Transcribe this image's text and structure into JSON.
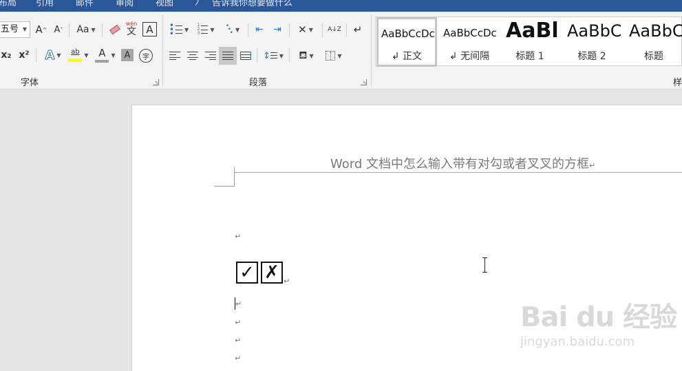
{
  "tabs": [
    {
      "label": "布局"
    },
    {
      "label": "引用"
    },
    {
      "label": "邮件"
    },
    {
      "label": "审阅"
    },
    {
      "label": "视图"
    }
  ],
  "tell_me": "告诉我你想要做什么",
  "font_group": {
    "label": "字体",
    "font_size": "五号",
    "change_case": "Aa",
    "phonetic_top": "wén",
    "phonetic_bottom": "文",
    "border_char": "A",
    "subscript": "x₂",
    "superscript": "x²",
    "text_effects": "A",
    "highlight": "ab",
    "font_color": "A",
    "char_shading": "A",
    "enclose_char": "字",
    "grow_font": "A",
    "shrink_font": "A"
  },
  "paragraph_group": {
    "label": "段落",
    "sort_label": "A↓Z"
  },
  "styles_group": {
    "label": "样式",
    "items": [
      {
        "sample": "AaBbCcDc",
        "name": "↲ 正文"
      },
      {
        "sample": "AaBbCcDc",
        "name": "↲ 无间隔"
      },
      {
        "sample": "AaBl",
        "name": "标题 1"
      },
      {
        "sample": "AaBbC",
        "name": "标题 2"
      },
      {
        "sample": "AaBbC",
        "name": "标题"
      }
    ]
  },
  "document": {
    "header_text": "Word 文档中怎么输入带有对勾或者叉叉的方框",
    "paragraph_mark": "↵",
    "check_box": "✓",
    "cross_box": "✗"
  },
  "watermark": {
    "brand": "Bai du 经验",
    "url": "jingyan.baidu.com"
  },
  "colors": {
    "title_bar": "#2b579a",
    "highlight_yellow": "#ffff00",
    "font_color_bar": "#c00000"
  }
}
